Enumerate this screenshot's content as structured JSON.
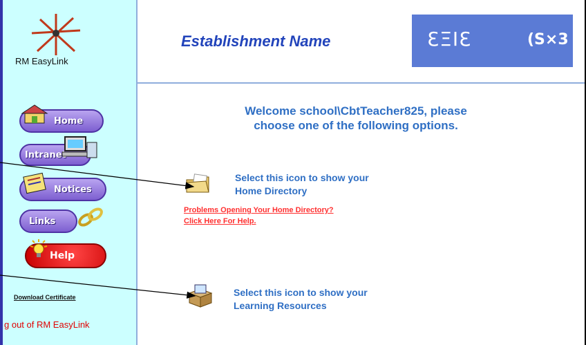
{
  "sidebar": {
    "logo_text": "RM EasyLink",
    "nav": {
      "home": "Home",
      "intranet": "Intranet",
      "notices": "Notices",
      "links": "Links",
      "help": "Help"
    },
    "download_certificate": "Download Certificate",
    "logout": "g out of RM EasyLink"
  },
  "header": {
    "establishment": "Establishment Name",
    "brand1": "ƐΞΙƐ",
    "brand2": "(S×3"
  },
  "main": {
    "welcome_line1": "Welcome school\\CbtTeacher825, please",
    "welcome_line2": "choose one of the following options.",
    "option1": {
      "line1": "Select this icon to show your",
      "line2": "Home Directory",
      "help1": "Problems Opening Your Home Directory?",
      "help2": "Click Here For Help."
    },
    "option2": {
      "line1": "Select this icon to show your",
      "line2": "Learning Resources"
    }
  },
  "colors": {
    "sidebar_bg": "#ccffff",
    "accent_blue": "#2f6fc4",
    "brand_box": "#5b7bd5",
    "link_red": "#ff3030"
  }
}
